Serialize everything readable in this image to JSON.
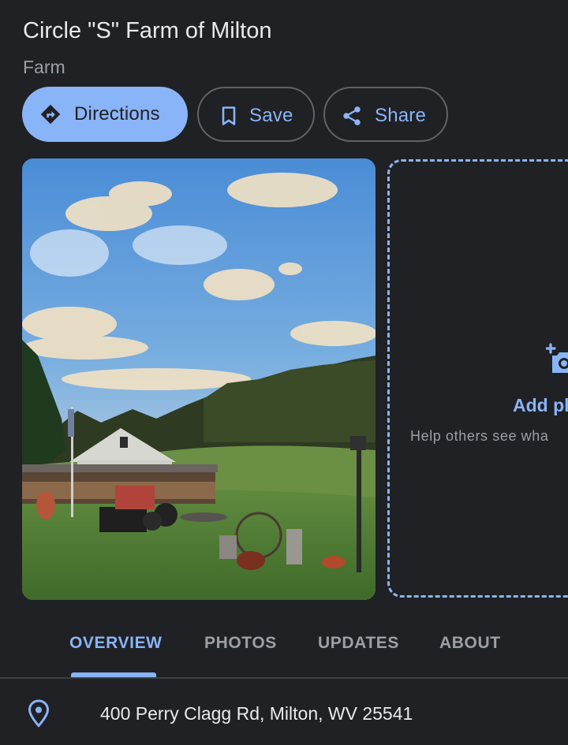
{
  "place": {
    "name": "Circle \"S\" Farm of Milton",
    "category": "Farm"
  },
  "actions": {
    "directions": {
      "label": "Directions",
      "icon": "directions-icon"
    },
    "save": {
      "label": "Save",
      "icon": "bookmark-icon"
    },
    "share": {
      "label": "Share",
      "icon": "share-icon"
    }
  },
  "photo_panel": {
    "add_label": "Add ph",
    "add_sub": "Help others see wha",
    "icon": "add-photo-camera-icon"
  },
  "tabs": [
    {
      "label": "OVERVIEW",
      "active": true
    },
    {
      "label": "PHOTOS",
      "active": false
    },
    {
      "label": "UPDATES",
      "active": false
    },
    {
      "label": "ABOUT",
      "active": false
    }
  ],
  "address": {
    "text": "400 Perry Clagg Rd, Milton, WV 25541",
    "icon": "location-pin-icon"
  },
  "colors": {
    "background": "#202124",
    "accent": "#8ab4f8",
    "primary_text": "#e8eaed",
    "secondary_text": "#9aa0a6",
    "outline": "#5f6368"
  }
}
